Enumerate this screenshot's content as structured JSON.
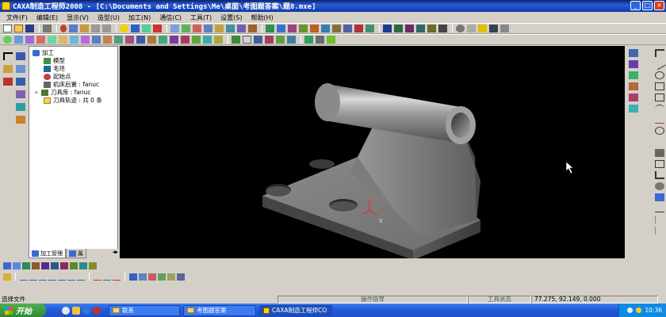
{
  "window": {
    "title": "CAXA制造工程师2008  - [C:\\Documents and Settings\\Me\\桌面\\考图题答案\\题8.mxe]",
    "controls": [
      "_",
      "□",
      "×"
    ]
  },
  "menu": [
    "文件(F)",
    "编辑(E)",
    "显示(V)",
    "造型(U)",
    "加工(N)",
    "通信(C)",
    "工具(T)",
    "设置(S)",
    "帮助(H)"
  ],
  "tree": {
    "root": "加工",
    "items": [
      {
        "label": "模型",
        "icon": "model-icon"
      },
      {
        "label": "毛坯",
        "icon": "blank-icon"
      },
      {
        "label": "起始点",
        "icon": "start-point-icon"
      },
      {
        "label": "机床后置 : fanuc",
        "icon": "machine-icon"
      },
      {
        "label": "刀具库 : fanuc",
        "icon": "tool-library-icon"
      },
      {
        "label": "刀具轨迹 : 共 0 条",
        "icon": "toolpath-folder-icon"
      }
    ],
    "tabs": [
      "加工管理",
      "属"
    ]
  },
  "viewport": {
    "background": "#000000",
    "axis_label_x": "X",
    "axis_label_z": "Z"
  },
  "statusbar": {
    "left": "选择文件",
    "command_hint": "操作指导",
    "tool_status": "工具状态",
    "coordinates": "77.275, 92.149, 0.000"
  },
  "taskbar": {
    "start": "开始",
    "tasks": [
      "联系",
      "考图题答案",
      "CAXA制造工程师CO"
    ],
    "clock": "10:36"
  },
  "colors": {
    "titlebar": "#0a246a",
    "viewport": "#000000",
    "panel": "#d4d0c8",
    "taskbar": "#245edb"
  }
}
